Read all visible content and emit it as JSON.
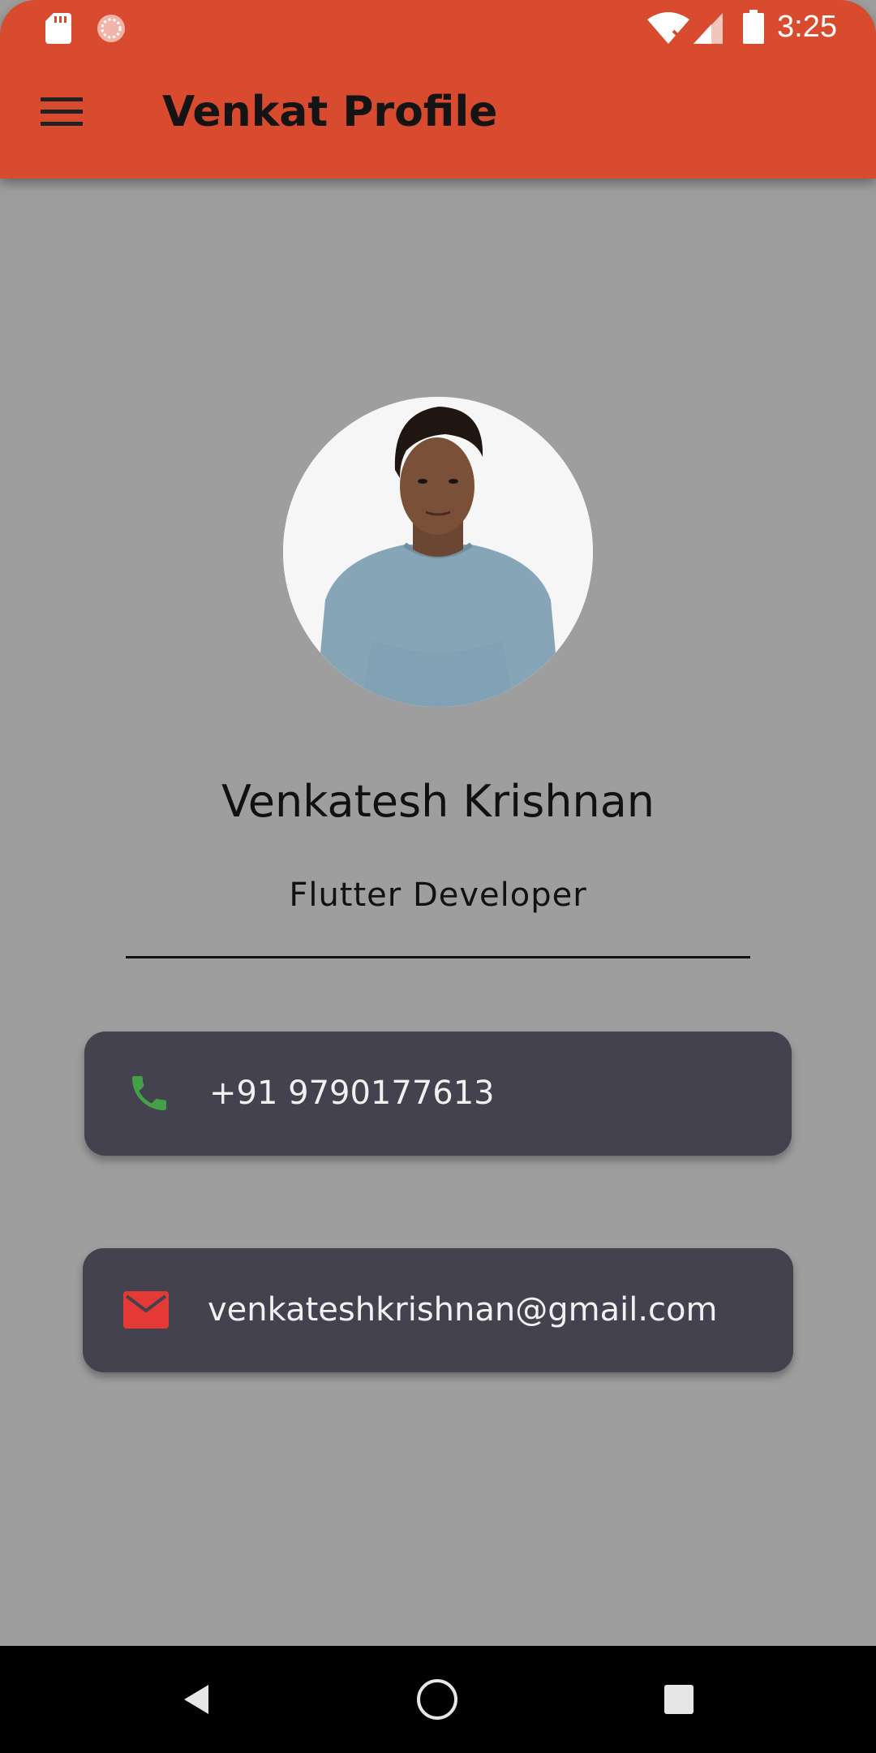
{
  "status_bar": {
    "time": "3:25",
    "icons": [
      "sd-card-icon",
      "sync-icon",
      "wifi-off-icon",
      "cell-signal-icon",
      "battery-icon"
    ]
  },
  "app_bar": {
    "title": "Venkat Profile",
    "menu_icon": "hamburger-menu-icon"
  },
  "profile": {
    "name": "Venkatesh Krishnan",
    "role": "Flutter Developer"
  },
  "contacts": [
    {
      "icon": "phone-icon",
      "value": "+91 9790177613",
      "icon_color": "#43a047"
    },
    {
      "icon": "email-icon",
      "value": "venkateshkrishnan@gmail.com",
      "icon_color": "#e53935"
    }
  ],
  "nav_bar": {
    "buttons": [
      "back-icon",
      "home-icon",
      "recents-icon"
    ]
  },
  "colors": {
    "app_bar": "#d84b2f",
    "background": "#9e9e9e",
    "card": "#45424f",
    "card_text": "#f1f1f1"
  }
}
